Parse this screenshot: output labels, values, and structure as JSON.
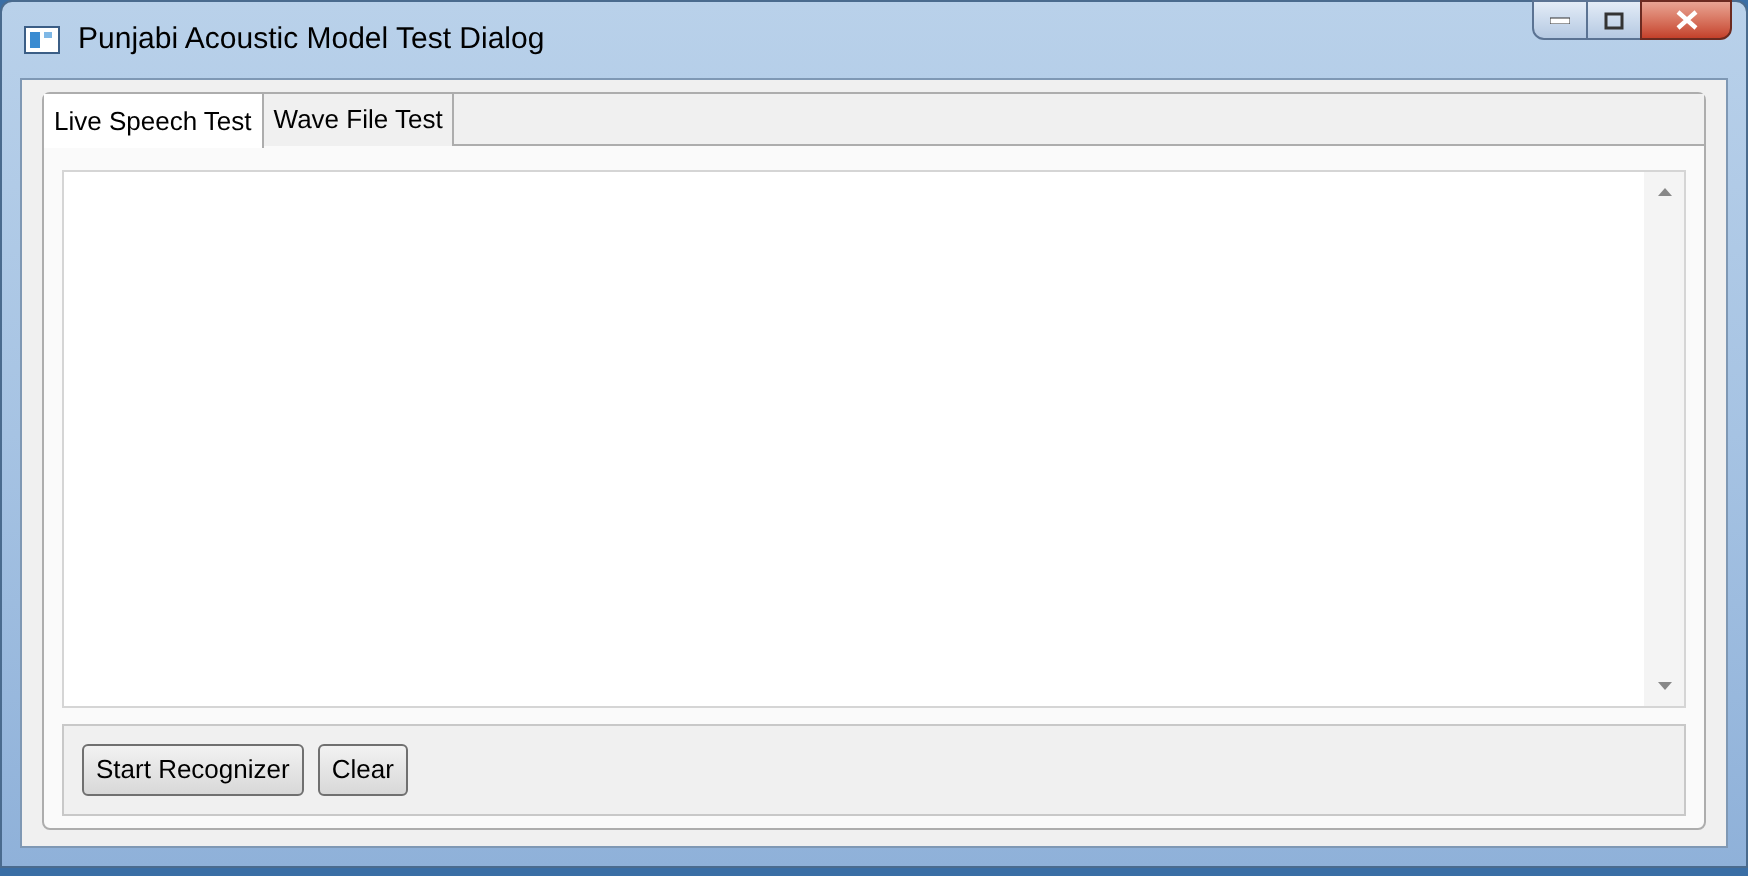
{
  "window": {
    "title": "Punjabi Acoustic Model Test Dialog"
  },
  "tabs": [
    {
      "label": "Live Speech Test",
      "selected": true
    },
    {
      "label": "Wave File Test",
      "selected": false
    }
  ],
  "buttons": [
    "Start Recognizer",
    "Clear"
  ]
}
